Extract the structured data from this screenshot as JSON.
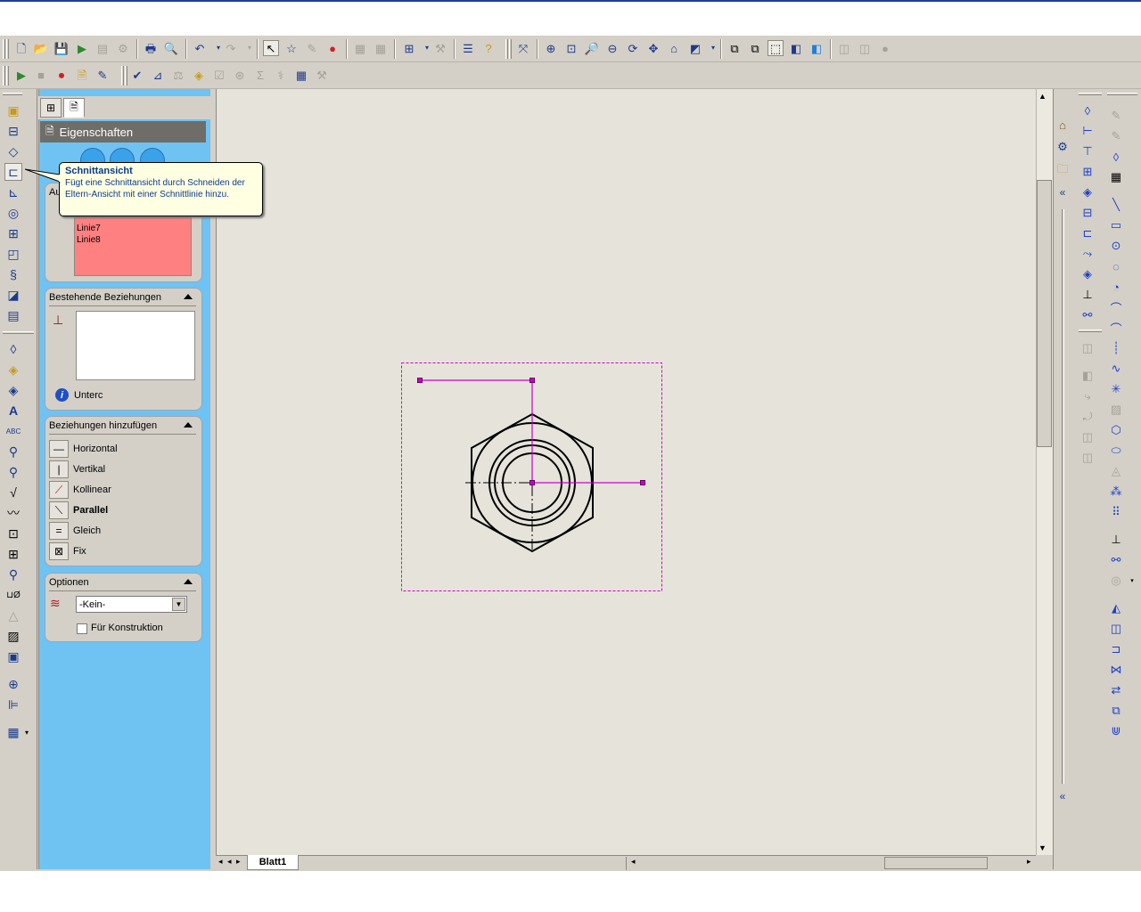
{
  "toolbar_top": {
    "icons": [
      "new-doc-icon",
      "open-icon",
      "save-icon",
      "rebuild-icon",
      "print-icon",
      "print-preview-icon",
      "undo-icon",
      "redo-icon",
      "select-icon",
      "smart-dimension-icon",
      "zoom-fit-icon",
      "zoom-area-icon",
      "zoom-in-icon",
      "rotate-icon",
      "pan-icon",
      "shaded-icon",
      "view-orientation-icon",
      "iso-view-icon"
    ]
  },
  "panel": {
    "header": "Eigenschaften",
    "selected_heading": "Au",
    "selected_items": [
      "Linie7",
      "Linie8"
    ],
    "existing_relations_title": "Bestehende Beziehungen",
    "info_text": "Unterc",
    "add_relations_title": "Beziehungen hinzufügen",
    "relations": [
      {
        "label": "Horizontal",
        "icon": "horizontal-icon",
        "bold": false
      },
      {
        "label": "Vertikal",
        "icon": "vertical-icon",
        "bold": false
      },
      {
        "label": "Kollinear",
        "icon": "collinear-icon",
        "bold": false
      },
      {
        "label": "Parallel",
        "icon": "parallel-icon",
        "bold": true
      },
      {
        "label": "Gleich",
        "icon": "equal-icon",
        "bold": false
      },
      {
        "label": "Fix",
        "icon": "fix-icon",
        "bold": false
      }
    ],
    "options_title": "Optionen",
    "layer_value": "-Kein-",
    "construction_label": "Für Konstruktion",
    "construction_checked": false
  },
  "tooltip": {
    "title": "Schnittansicht",
    "body": "Fügt eine Schnittansicht durch Schneiden der Eltern-Ansicht mit einer Schnittlinie hinzu."
  },
  "sheet": {
    "tab_label": "Blatt1"
  },
  "colors": {
    "panel_bg": "#6ec3f2",
    "selection_list": "#ff8080",
    "sketch_line": "#cc00cc",
    "canvas_bg": "#e6e4da"
  }
}
